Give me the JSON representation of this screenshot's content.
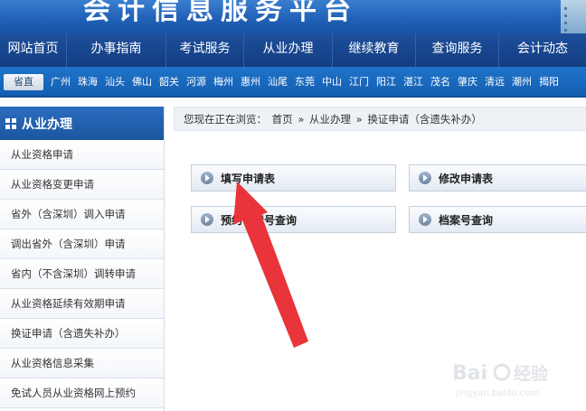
{
  "banner": {
    "title": "会计信息服务平台"
  },
  "nav": {
    "items": [
      "网站首页",
      "办事指南",
      "考试服务",
      "从业办理",
      "继续教育",
      "查询服务",
      "会计动态"
    ]
  },
  "citybar": {
    "province_label": "省直",
    "cities": [
      "广州",
      "珠海",
      "汕头",
      "佛山",
      "韶关",
      "河源",
      "梅州",
      "惠州",
      "汕尾",
      "东莞",
      "中山",
      "江门",
      "阳江",
      "湛江",
      "茂名",
      "肇庆",
      "清远",
      "潮州",
      "揭阳"
    ]
  },
  "sidebar": {
    "title": "从业办理",
    "items": [
      "从业资格申请",
      "从业资格变更申请",
      "省外（含深圳）调入申请",
      "调出省外（含深圳）申请",
      "省内（不含深圳）调转申请",
      "从业资格延续有效期申请",
      "换证申请（含遗失补办）",
      "从业资格信息采集",
      "免试人员从业资格网上预约"
    ]
  },
  "breadcrumb": {
    "prefix": "您现在正在浏览：",
    "home": "首页",
    "sep": "»",
    "section": "从业办理",
    "current": "换证申请（含遗失补办）"
  },
  "services": {
    "fill_form": "填写申请表",
    "modify_form": "修改申请表",
    "appointment_query": "预约申请号查询",
    "archive_query": "档案号查询"
  },
  "colors": {
    "nav_bg": "#133d80",
    "citybar_bg": "#1f73c9",
    "arrow": "#e8343a"
  },
  "watermark": {
    "text": "Bai 经验",
    "url": "jingyan.baidu.com"
  }
}
